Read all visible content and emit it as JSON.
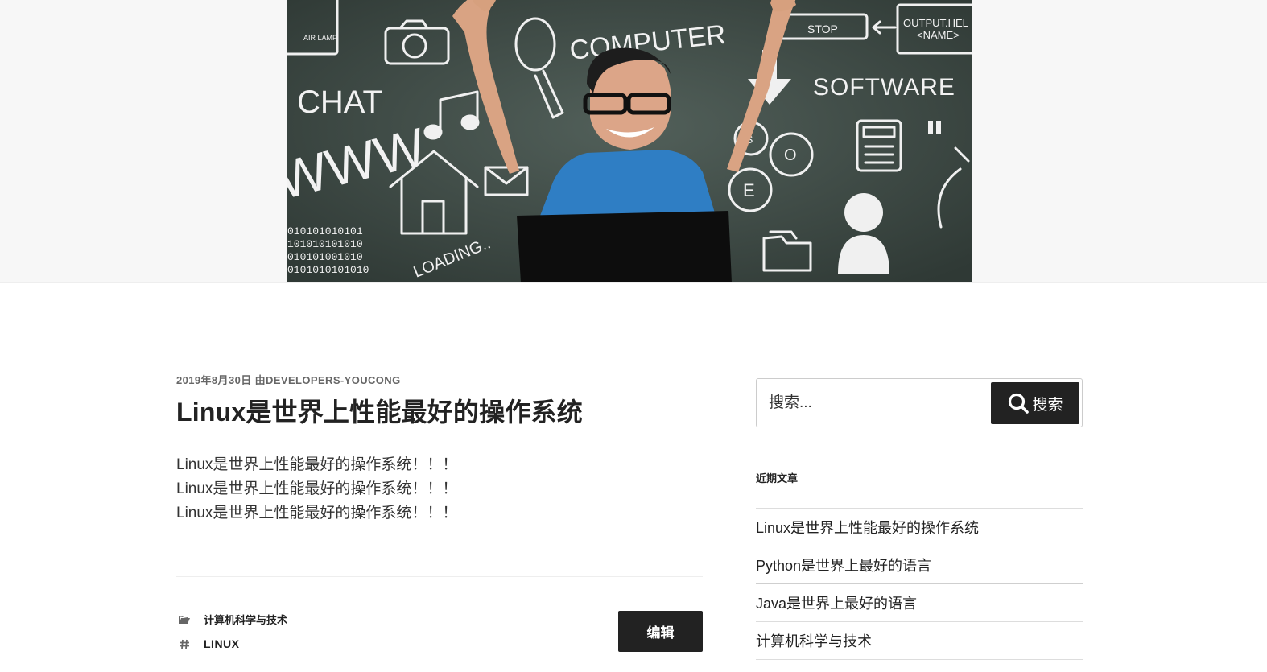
{
  "hero": {
    "chalk_words": [
      "COMPUTER",
      "SOFTWARE",
      "CHAT",
      "WWW",
      "STOP",
      "OUTPUT.HEL",
      "<NAME>",
      "AIR LAMP",
      "LOADING..",
      "S",
      "O",
      "E"
    ],
    "binary_lines": [
      "010101010101",
      "101010101010",
      "010101001010",
      "0101010101010"
    ],
    "icons": [
      "camera-icon",
      "magnifier-icon",
      "music-note-icon",
      "house-icon",
      "envelope-icon",
      "arrow-down-icon",
      "gears-icon",
      "calculator-icon",
      "folder-icon",
      "person-icon",
      "pause-icon",
      "bell-icon"
    ]
  },
  "article": {
    "date": "2019年8月30日",
    "by": "由",
    "author": "DEVELOPERS-YOUCONG",
    "title": "Linux是世界上性能最好的操作系统",
    "paragraphs": [
      "Linux是世界上性能最好的操作系统！！！",
      "Linux是世界上性能最好的操作系统！！！",
      "Linux是世界上性能最好的操作系统！！！"
    ],
    "category": "计算机科学与技术",
    "tag": "LINUX",
    "edit_label": "编辑",
    "icons": {
      "category": "folder-icon",
      "tag": "hashtag-icon"
    }
  },
  "sidebar": {
    "search_placeholder": "搜索...",
    "search_button": "搜索",
    "recent_title": "近期文章",
    "recent_posts": [
      "Linux是世界上性能最好的操作系统",
      "Python是世界上最好的语言",
      "Java是世界上最好的语言",
      "计算机科学与技术"
    ]
  },
  "colors": {
    "button_bg": "#222222",
    "chalkboard": "#3e4a45",
    "chalk": "#f2f2f2"
  }
}
